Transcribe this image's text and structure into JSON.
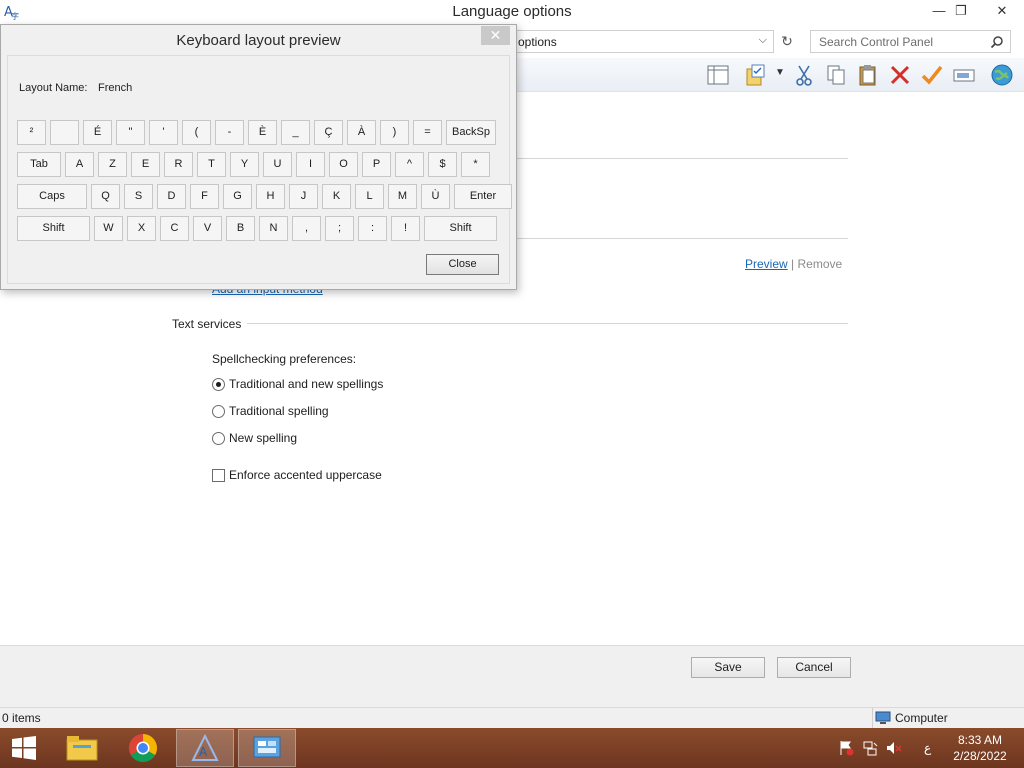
{
  "window": {
    "title": "Language options",
    "buttons": {
      "minimize": "—",
      "maximize": "❐",
      "close": "✕"
    }
  },
  "address": {
    "path_visible": "options"
  },
  "search": {
    "placeholder": "Search Control Panel"
  },
  "toolbar_icons": [
    "layout-icon",
    "properties-icon",
    "cut-icon",
    "copy-icon",
    "paste-icon",
    "delete-icon",
    "checkmark-icon",
    "rename-icon",
    "globe-icon"
  ],
  "input_methods": {
    "preview_link": "Preview",
    "separator": "|",
    "remove_link": "Remove",
    "add_link": "Add an input method"
  },
  "text_services": {
    "heading": "Text services",
    "spellcheck_heading": "Spellchecking preferences:",
    "options": [
      {
        "label": "Traditional and new spellings",
        "checked": true
      },
      {
        "label": "Traditional spelling",
        "checked": false
      },
      {
        "label": "New spelling",
        "checked": false
      }
    ],
    "enforce_label": "Enforce accented uppercase",
    "enforce_checked": false
  },
  "footer": {
    "save": "Save",
    "cancel": "Cancel"
  },
  "status": {
    "items": "0 items",
    "location": "Computer"
  },
  "dialog": {
    "title": "Keyboard layout preview",
    "close_glyph": "✕",
    "layout_name_label": "Layout Name:",
    "layout_name_value": "French",
    "close_button": "Close",
    "rows": [
      [
        "²",
        "",
        "É",
        "\"",
        "'",
        "(",
        "-",
        "È",
        "_",
        "Ç",
        "À",
        ")",
        "=",
        "BackSp"
      ],
      [
        "Tab",
        "A",
        "Z",
        "E",
        "R",
        "T",
        "Y",
        "U",
        "I",
        "O",
        "P",
        "^",
        "$",
        "*"
      ],
      [
        "Caps",
        "Q",
        "S",
        "D",
        "F",
        "G",
        "H",
        "J",
        "K",
        "L",
        "M",
        "Ù",
        "Enter"
      ],
      [
        "Shift",
        "W",
        "X",
        "C",
        "V",
        "B",
        "N",
        ",",
        ";",
        ":",
        "!",
        "Shift"
      ]
    ]
  },
  "taskbar": {
    "lang": "ع",
    "time": "8:33 AM",
    "date": "2/28/2022"
  }
}
